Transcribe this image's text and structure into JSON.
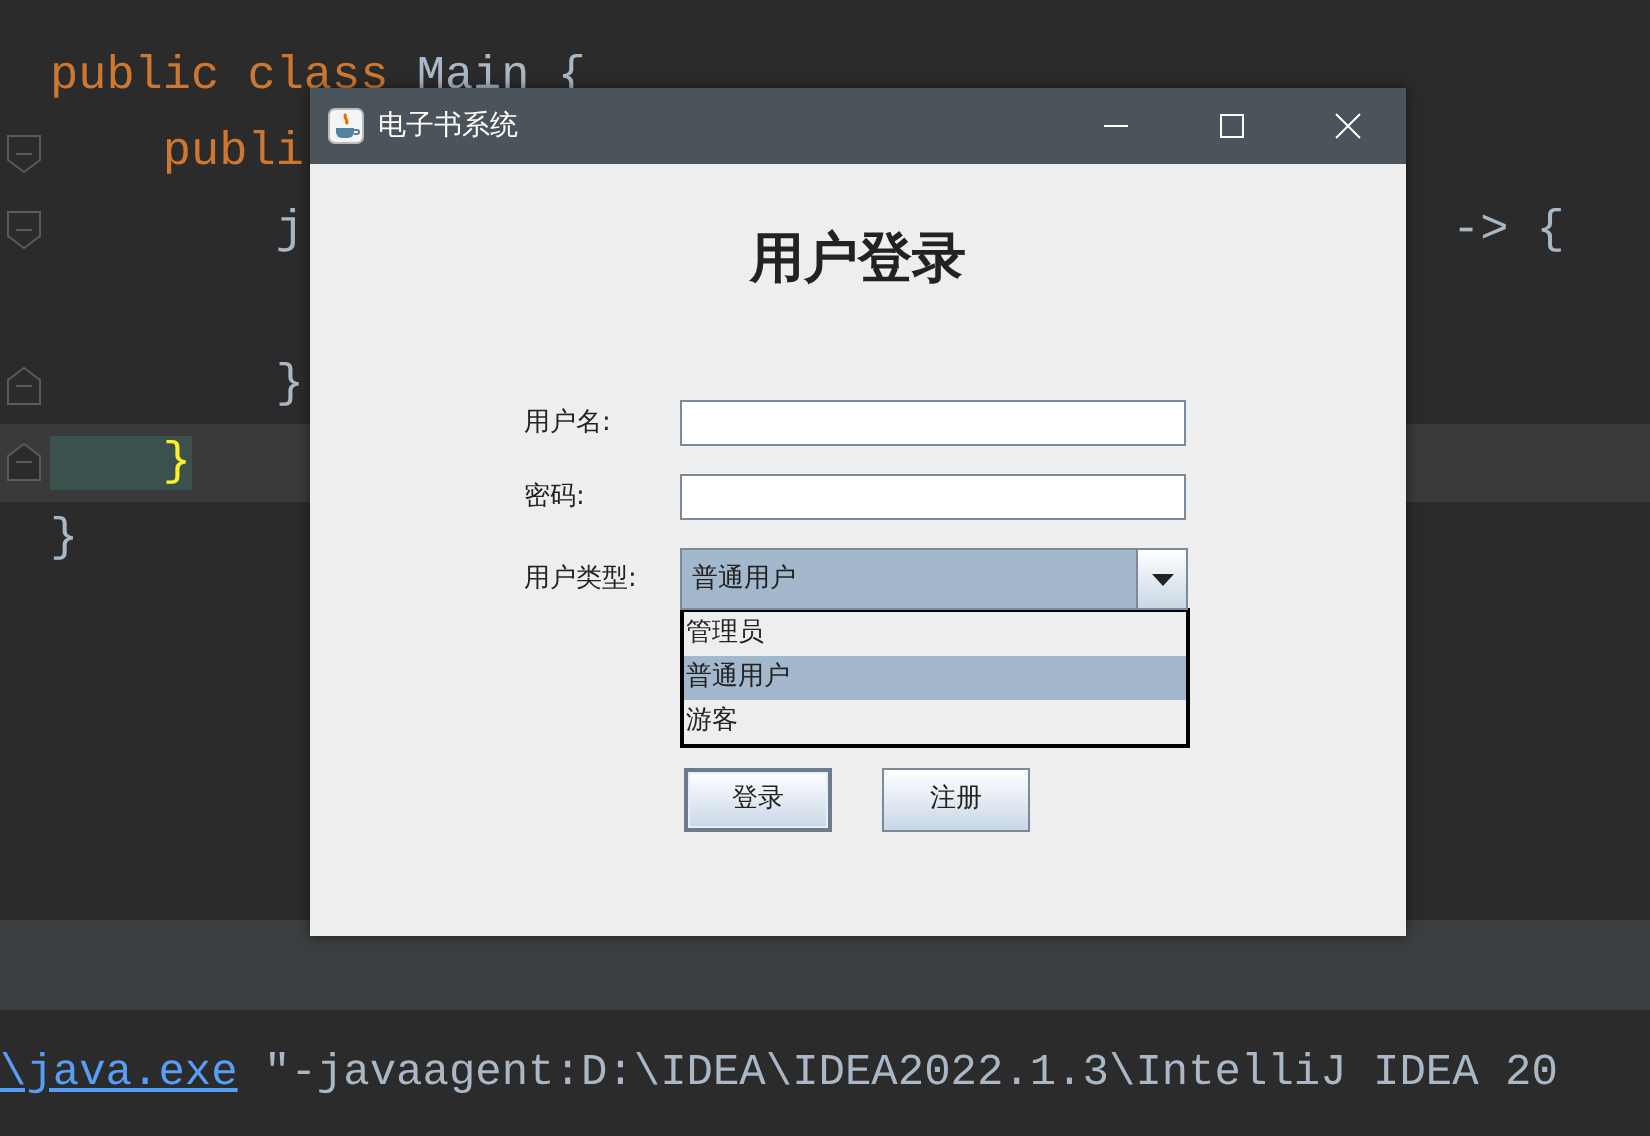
{
  "editor": {
    "lines": [
      {
        "kind": "plain",
        "current": false,
        "segments": [
          {
            "kind": "keyword",
            "text": "public class"
          },
          {
            "kind": "plain",
            "text": " Main {"
          }
        ]
      },
      {
        "kind": "fold-start",
        "current": false,
        "segments": [
          {
            "kind": "keyword",
            "text": "    publi"
          }
        ]
      },
      {
        "kind": "fold-start",
        "current": false,
        "segments": [
          {
            "kind": "plain",
            "text": "        j"
          }
        ],
        "trailing": "-> {"
      },
      {
        "kind": "plain",
        "current": false
      },
      {
        "kind": "fold-end",
        "current": false,
        "segments": [
          {
            "kind": "plain",
            "text": "        }"
          }
        ]
      },
      {
        "kind": "fold-end",
        "current": true,
        "segments": [
          {
            "kind": "brace-match",
            "text": "    }"
          }
        ]
      },
      {
        "kind": "plain",
        "current": false,
        "segments": [
          {
            "kind": "plain",
            "text": "}"
          }
        ]
      }
    ]
  },
  "console": {
    "segments": [
      {
        "kind": "link",
        "text": "\\java.exe"
      },
      {
        "kind": "plain",
        "text": " \"-javaagent:D:\\IDEA\\IDEA2022.1.3\\IntelliJ IDEA 20"
      }
    ]
  },
  "dialog": {
    "title": "电子书系统",
    "heading": "用户登录",
    "fields": [
      {
        "label": "用户名:"
      },
      {
        "label": "密码:"
      }
    ],
    "user_type": {
      "label": "用户类型:",
      "value": "普通用户",
      "expanded": true,
      "options": [
        {
          "text": "管理员",
          "selected": false
        },
        {
          "text": "普通用户",
          "selected": true
        },
        {
          "text": "游客",
          "selected": false
        }
      ]
    },
    "buttons": [
      {
        "label": "登录",
        "focused": true
      },
      {
        "label": "注册",
        "focused": false
      }
    ]
  }
}
